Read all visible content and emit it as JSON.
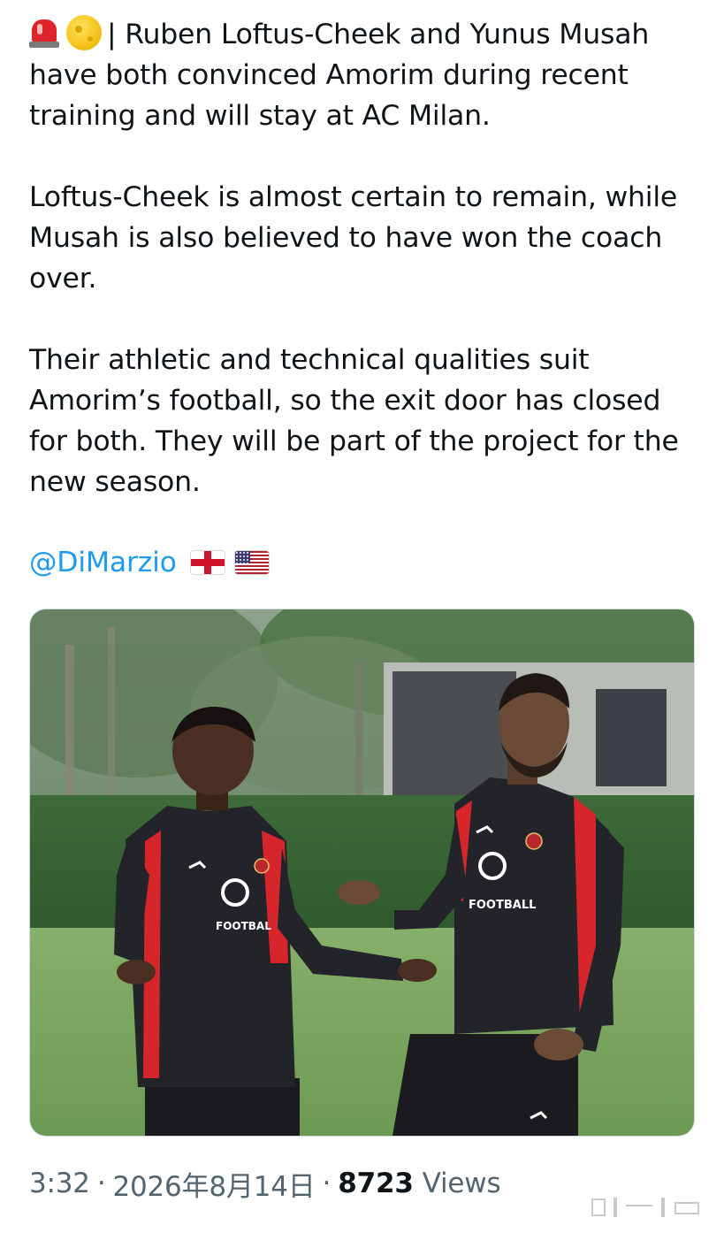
{
  "tweet": {
    "paragraphs": [
      {
        "emoji": [
          "siren-icon",
          "moon-icon"
        ],
        "text": "| Ruben Loftus-Cheek and Yunus Musah have both convinced Amorim during recent training and will stay at AC Milan."
      },
      {
        "text": "Loftus-Cheek is almost certain to remain, while Musah is also believed to have won the coach over."
      },
      {
        "text": "Their athletic and technical qualities suit Amorim’s football, so the exit door has closed for both. They will be part of the project for the new season."
      }
    ],
    "mention": "@DiMarzio",
    "mention_flags": [
      "england-flag-icon",
      "usa-flag-icon"
    ],
    "photo": {
      "alt": "Photo of two AC Milan players in training jackets",
      "jacket_text": [
        "FOOTBAL",
        "FOOTBALL"
      ]
    },
    "meta": {
      "time": "3:32",
      "separator": "·",
      "date": "2026年8月14日",
      "views_count": "8723",
      "views_label": "Views"
    }
  },
  "colors": {
    "link": "#1d9bf0",
    "text": "#0f1419",
    "secondary_text": "#536471",
    "jacket": "#23232a",
    "jacket_red": "#d6262c"
  }
}
